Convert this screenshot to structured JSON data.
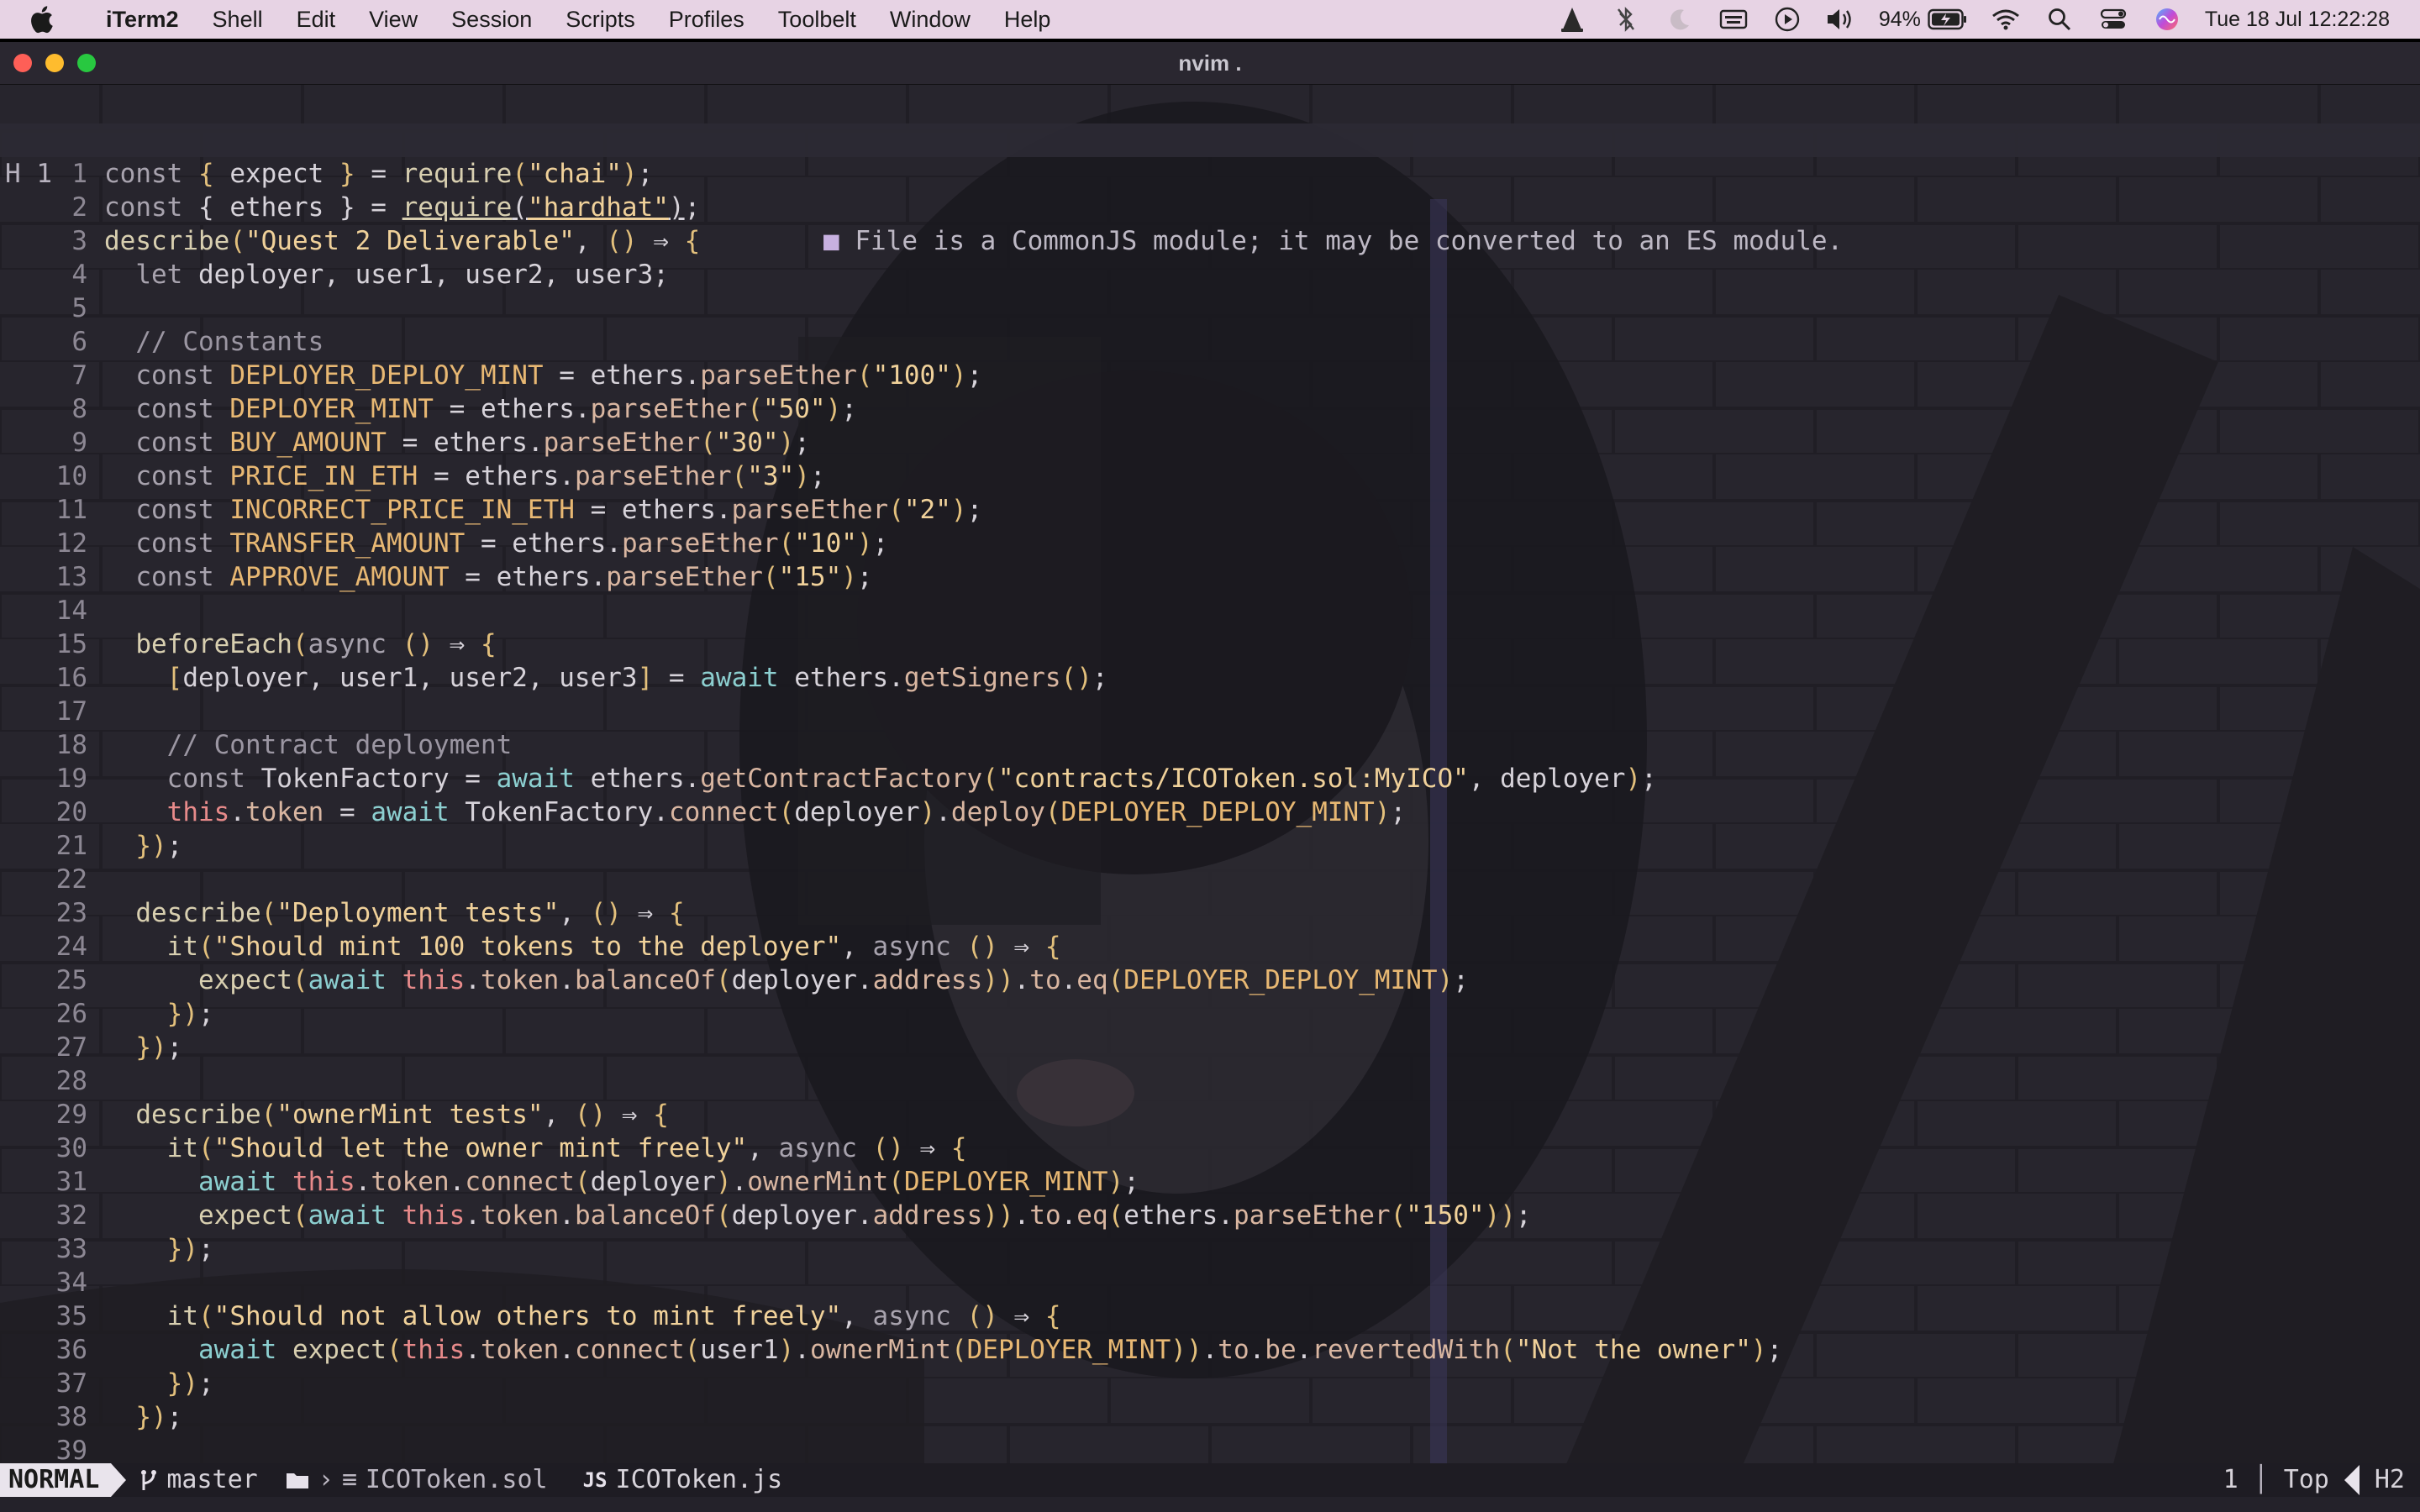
{
  "menubar": {
    "apple_icon": "apple-logo",
    "items": [
      "iTerm2",
      "Shell",
      "Edit",
      "View",
      "Session",
      "Scripts",
      "Profiles",
      "Toolbelt",
      "Window",
      "Help"
    ],
    "battery_percent": "94%",
    "datetime": "Tue 18 Jul  12:22:28",
    "tray_icons": [
      "vlc-icon",
      "bluetooth-icon",
      "moon-icon",
      "keyboard-icon",
      "play-icon",
      "volume-icon",
      "battery-icon",
      "wifi-icon",
      "search-icon",
      "control-center-icon",
      "siri-icon"
    ]
  },
  "window": {
    "title": "nvim ."
  },
  "editor": {
    "header_line": {
      "label": "H 1",
      "code": "const { ethers } = require(\"hardhat\");",
      "diagnostic_marker": "■",
      "diagnostic": "File is a CommonJS module; it may be converted to an ES module."
    },
    "lines": [
      {
        "n": "1",
        "t": "const { expect } = require(\"chai\");"
      },
      {
        "n": "2",
        "t": ""
      },
      {
        "n": "3",
        "t": "describe(\"Quest 2 Deliverable\", () ⇒ {"
      },
      {
        "n": "4",
        "t": "  let deployer, user1, user2, user3;"
      },
      {
        "n": "5",
        "t": ""
      },
      {
        "n": "6",
        "t": "  // Constants"
      },
      {
        "n": "7",
        "t": "  const DEPLOYER_DEPLOY_MINT = ethers.parseEther(\"100\");"
      },
      {
        "n": "8",
        "t": "  const DEPLOYER_MINT = ethers.parseEther(\"50\");"
      },
      {
        "n": "9",
        "t": "  const BUY_AMOUNT = ethers.parseEther(\"30\");"
      },
      {
        "n": "10",
        "t": "  const PRICE_IN_ETH = ethers.parseEther(\"3\");"
      },
      {
        "n": "11",
        "t": "  const INCORRECT_PRICE_IN_ETH = ethers.parseEther(\"2\");"
      },
      {
        "n": "12",
        "t": "  const TRANSFER_AMOUNT = ethers.parseEther(\"10\");"
      },
      {
        "n": "13",
        "t": "  const APPROVE_AMOUNT = ethers.parseEther(\"15\");"
      },
      {
        "n": "14",
        "t": ""
      },
      {
        "n": "15",
        "t": "  beforeEach(async () ⇒ {"
      },
      {
        "n": "16",
        "t": "    [deployer, user1, user2, user3] = await ethers.getSigners();"
      },
      {
        "n": "17",
        "t": ""
      },
      {
        "n": "18",
        "t": "    // Contract deployment"
      },
      {
        "n": "19",
        "t": "    const TokenFactory = await ethers.getContractFactory(\"contracts/ICOToken.sol:MyICO\", deployer);"
      },
      {
        "n": "20",
        "t": "    this.token = await TokenFactory.connect(deployer).deploy(DEPLOYER_DEPLOY_MINT);"
      },
      {
        "n": "21",
        "t": "  });"
      },
      {
        "n": "22",
        "t": ""
      },
      {
        "n": "23",
        "t": "  describe(\"Deployment tests\", () ⇒ {"
      },
      {
        "n": "24",
        "t": "    it(\"Should mint 100 tokens to the deployer\", async () ⇒ {"
      },
      {
        "n": "25",
        "t": "      expect(await this.token.balanceOf(deployer.address)).to.eq(DEPLOYER_DEPLOY_MINT);"
      },
      {
        "n": "26",
        "t": "    });"
      },
      {
        "n": "27",
        "t": "  });"
      },
      {
        "n": "28",
        "t": ""
      },
      {
        "n": "29",
        "t": "  describe(\"ownerMint tests\", () ⇒ {"
      },
      {
        "n": "30",
        "t": "    it(\"Should let the owner mint freely\", async () ⇒ {"
      },
      {
        "n": "31",
        "t": "      await this.token.connect(deployer).ownerMint(DEPLOYER_MINT);"
      },
      {
        "n": "32",
        "t": "      expect(await this.token.balanceOf(deployer.address)).to.eq(ethers.parseEther(\"150\"));"
      },
      {
        "n": "33",
        "t": "    });"
      },
      {
        "n": "34",
        "t": ""
      },
      {
        "n": "35",
        "t": "    it(\"Should not allow others to mint freely\", async () ⇒ {"
      },
      {
        "n": "36",
        "t": "      await expect(this.token.connect(user1).ownerMint(DEPLOYER_MINT)).to.be.revertedWith(\"Not the owner\");"
      },
      {
        "n": "37",
        "t": "    });"
      },
      {
        "n": "38",
        "t": "  });"
      },
      {
        "n": "39",
        "t": ""
      }
    ]
  },
  "statusline": {
    "mode": "NORMAL",
    "branch_icon": "git-branch-icon",
    "branch": "master",
    "folder_icon": "folder-icon",
    "sol_icon": "≡",
    "file1": "ICOToken.sol",
    "js_badge": "JS",
    "file2": "ICOToken.js",
    "line_info": "1",
    "position": "Top",
    "right_label": "H2"
  },
  "colors": {
    "menubar_bg": "#e7d3e4",
    "editor_bg": "#24222a",
    "string": "#f0d19a",
    "constant": "#e8b873",
    "await": "#8ccfd0",
    "this": "#e78a8a"
  }
}
